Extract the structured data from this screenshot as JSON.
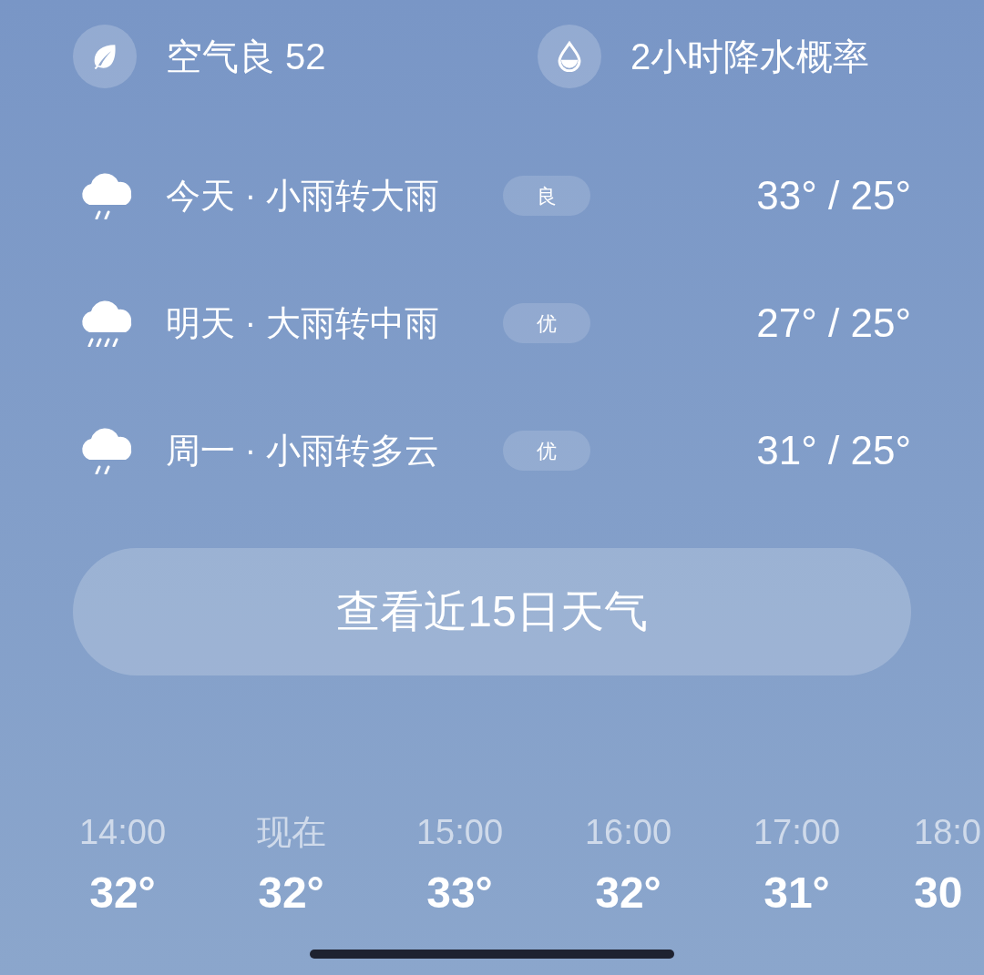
{
  "air_quality": {
    "label": "空气良 52"
  },
  "precipitation": {
    "label": "2小时降水概率"
  },
  "forecast": [
    {
      "label": "今天 · 小雨转大雨",
      "aqi": "良",
      "temps": "33° / 25°",
      "kind": "light-rain"
    },
    {
      "label": "明天 · 大雨转中雨",
      "aqi": "优",
      "temps": "27° / 25°",
      "kind": "heavy-rain"
    },
    {
      "label": "周一 · 小雨转多云",
      "aqi": "优",
      "temps": "31° / 25°",
      "kind": "light-rain"
    }
  ],
  "more_button": {
    "label": "查看近15日天气"
  },
  "hourly": [
    {
      "time": "14:00",
      "temp": "32°"
    },
    {
      "time": "现在",
      "temp": "32°"
    },
    {
      "time": "15:00",
      "temp": "33°"
    },
    {
      "time": "16:00",
      "temp": "32°"
    },
    {
      "time": "17:00",
      "temp": "31°"
    },
    {
      "time": "18:0",
      "temp": "30"
    }
  ]
}
